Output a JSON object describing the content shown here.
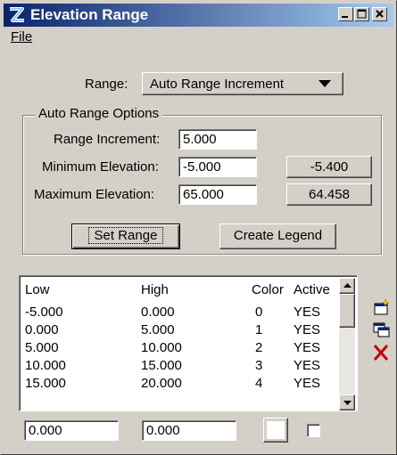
{
  "window": {
    "title": "Elevation Range"
  },
  "menu": {
    "file": "File"
  },
  "range": {
    "label": "Range:",
    "selected": "Auto Range Increment"
  },
  "options": {
    "group_title": "Auto Range Options",
    "increment_label": "Range Increment:",
    "increment_value": "5.000",
    "min_label": "Minimum Elevation:",
    "min_value": "-5.000",
    "min_button": "-5.400",
    "max_label": "Maximum Elevation:",
    "max_value": "65.000",
    "max_button": "64.458",
    "set_range": "Set Range",
    "create_legend": "Create Legend"
  },
  "table": {
    "headers": {
      "low": "Low",
      "high": "High",
      "color": "Color",
      "active": "Active"
    },
    "rows": [
      {
        "low": "-5.000",
        "high": "0.000",
        "color": "0",
        "active": "YES"
      },
      {
        "low": "0.000",
        "high": "5.000",
        "color": "1",
        "active": "YES"
      },
      {
        "low": "5.000",
        "high": "10.000",
        "color": "2",
        "active": "YES"
      },
      {
        "low": "10.000",
        "high": "15.000",
        "color": "3",
        "active": "YES"
      },
      {
        "low": "15.000",
        "high": "20.000",
        "color": "4",
        "active": "YES"
      }
    ]
  },
  "edit": {
    "low": "0.000",
    "high": "0.000",
    "color_swatch": "#ffffff",
    "active_checked": false
  },
  "icons": {
    "add": "add-row-icon",
    "copy": "copy-row-icon",
    "delete": "delete-row-icon"
  },
  "colors": {
    "titlebar_start": "#0a246a",
    "titlebar_end": "#a6caf0",
    "face": "#d4d0c8",
    "delete_red": "#cc0000"
  }
}
